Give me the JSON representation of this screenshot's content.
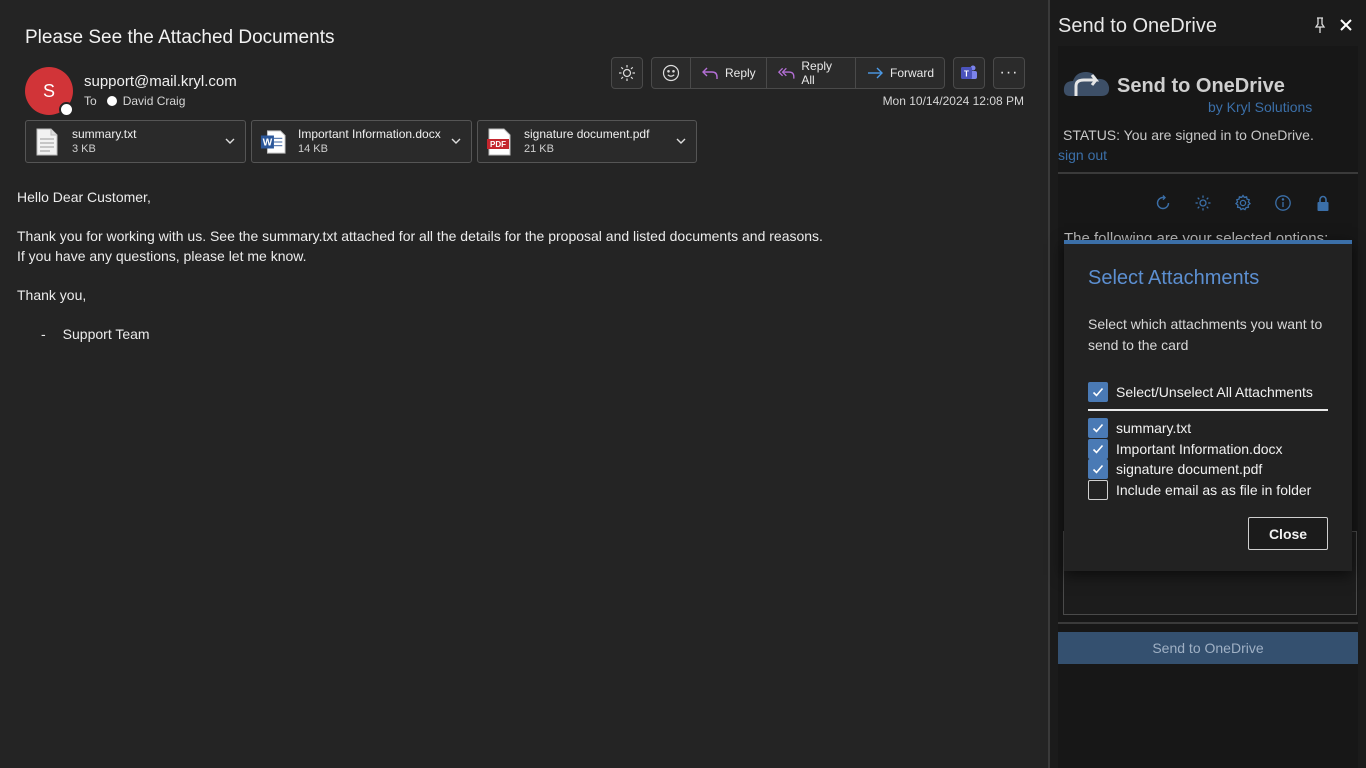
{
  "email": {
    "subject": "Please See the Attached Documents",
    "avatar_initial": "S",
    "sender": "support@mail.kryl.com",
    "to_label": "To",
    "to_name": "David Craig",
    "date": "Mon 10/14/2024 12:08 PM",
    "toolbar": {
      "reply": "Reply",
      "reply_all": "Reply All",
      "forward": "Forward",
      "more": "···"
    },
    "attachments": [
      {
        "name": "summary.txt",
        "size": "3 KB",
        "icon": "text-file-icon"
      },
      {
        "name": "Important Information.docx",
        "size": "14 KB",
        "icon": "word-file-icon"
      },
      {
        "name": "signature document.pdf",
        "size": "21 KB",
        "icon": "pdf-file-icon"
      }
    ],
    "body": {
      "greeting": "Hello Dear Customer,",
      "line1": "Thank you for working with us. See the summary.txt attached for all the details for the proposal and listed documents and reasons.",
      "line2": "If you have any questions, please let me know.",
      "closing": "Thank you,",
      "sig_dash": "-",
      "signature": "Support Team"
    }
  },
  "pane": {
    "title": "Send to OneDrive",
    "addin_title": "Send to OneDrive",
    "addin_by": "by Kryl Solutions",
    "status": "STATUS: You are signed in to OneDrive.",
    "sign_out": "sign out",
    "following": "The following are your selected options:",
    "send_button": "Send to OneDrive"
  },
  "modal": {
    "title": "Select Attachments",
    "description": "Select which attachments you want to send to the card",
    "select_all": "Select/Unselect All Attachments",
    "items": [
      {
        "label": "summary.txt",
        "checked": true
      },
      {
        "label": "Important Information.docx",
        "checked": true
      },
      {
        "label": "signature document.pdf",
        "checked": true
      },
      {
        "label": "Include email as as file in folder",
        "checked": false
      }
    ],
    "close": "Close"
  },
  "colors": {
    "accent": "#3b6fa8",
    "avatar": "#d13438",
    "reply_purple": "#b46fd6",
    "forward_blue": "#4c9be8"
  }
}
